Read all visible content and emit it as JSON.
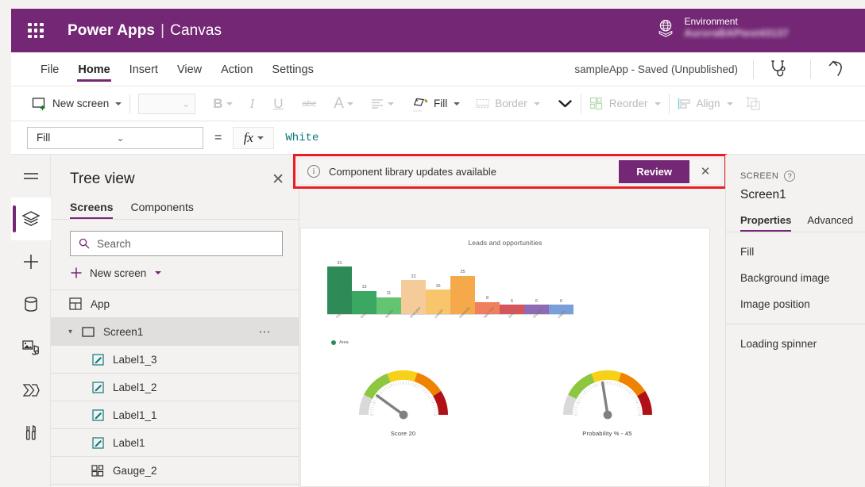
{
  "topbar": {
    "waffle_icon": "app-launcher-icon",
    "brand": "Power Apps",
    "separator": "|",
    "product": "Canvas",
    "environment_label": "Environment",
    "environment_name": "AuroraBAPtest43137",
    "globe_icon": "environment-globe-icon",
    "accent": "#742774"
  },
  "menubar": {
    "items": [
      {
        "label": "File",
        "active": false
      },
      {
        "label": "Home",
        "active": true
      },
      {
        "label": "Insert",
        "active": false
      },
      {
        "label": "View",
        "active": false
      },
      {
        "label": "Action",
        "active": false
      },
      {
        "label": "Settings",
        "active": false
      }
    ],
    "app_status": "sampleApp - Saved (Unpublished)",
    "checker_icon": "app-checker-stethoscope-icon",
    "undo_icon": "undo-arrow-icon"
  },
  "ribbon": {
    "new_screen": "New screen",
    "new_screen_icon": "new-screen-icon",
    "font_value": "",
    "bold": "B",
    "italic": "I",
    "underline": "U",
    "strikethrough": "abc",
    "font_color_icon": "font-color-icon",
    "align_icon": "text-align-icon",
    "fill": "Fill",
    "fill_icon": "fill-bucket-icon",
    "border": "Border",
    "border_icon": "border-icon",
    "more_icon": "chevron-down-icon",
    "reorder": "Reorder",
    "reorder_icon": "reorder-icon",
    "align": "Align",
    "align_tool_icon": "align-icon",
    "group_icon": "group-icon"
  },
  "formula_bar": {
    "property": "Fill",
    "equals": "=",
    "fx": "fx",
    "value": "White"
  },
  "rail": {
    "items": [
      {
        "name": "menu-hamburger",
        "icon": "hamburger-icon",
        "active": false
      },
      {
        "name": "tree-view",
        "icon": "layers-icon",
        "active": true
      },
      {
        "name": "insert",
        "icon": "plus-icon",
        "active": false
      },
      {
        "name": "data",
        "icon": "database-icon",
        "active": false
      },
      {
        "name": "media",
        "icon": "media-icon",
        "active": false
      },
      {
        "name": "power-automate",
        "icon": "power-automate-icon",
        "active": false
      },
      {
        "name": "advanced-tools",
        "icon": "advanced-tools-icon",
        "active": false
      }
    ]
  },
  "tree_view": {
    "title": "Tree view",
    "close_icon": "close-icon",
    "tabs": [
      {
        "label": "Screens",
        "active": true
      },
      {
        "label": "Components",
        "active": false
      }
    ],
    "search_placeholder": "Search",
    "search_value": "",
    "search_icon": "search-icon",
    "new_screen": "New screen",
    "new_screen_plus_icon": "plus-icon",
    "new_screen_chevron_icon": "chevron-down-icon",
    "items": [
      {
        "label": "App",
        "icon": "app-icon",
        "level": 0,
        "selected": false,
        "expandable": false,
        "overflow": false
      },
      {
        "label": "Screen1",
        "icon": "screen-icon",
        "level": 0,
        "selected": true,
        "expandable": true,
        "overflow": true,
        "overflow_icon": "more-options-icon"
      },
      {
        "label": "Label1_3",
        "icon": "label-icon",
        "level": 1,
        "selected": false,
        "expandable": false,
        "overflow": false
      },
      {
        "label": "Label1_2",
        "icon": "label-icon",
        "level": 1,
        "selected": false,
        "expandable": false,
        "overflow": false
      },
      {
        "label": "Label1_1",
        "icon": "label-icon",
        "level": 1,
        "selected": false,
        "expandable": false,
        "overflow": false
      },
      {
        "label": "Label1",
        "icon": "label-icon",
        "level": 1,
        "selected": false,
        "expandable": false,
        "overflow": false
      },
      {
        "label": "Gauge_2",
        "icon": "gauge-component-icon",
        "level": 1,
        "selected": false,
        "expandable": false,
        "overflow": false
      }
    ]
  },
  "banner": {
    "info_icon": "info-icon",
    "message": "Component library updates available",
    "review_label": "Review",
    "close_icon": "close-icon",
    "highlight_color": "#ed1c24",
    "button_color": "#742774"
  },
  "properties_panel": {
    "kind": "SCREEN",
    "help_icon": "help-question-icon",
    "name": "Screen1",
    "tabs": [
      {
        "label": "Properties",
        "active": true
      },
      {
        "label": "Advanced",
        "active": false
      }
    ],
    "group1": [
      "Fill",
      "Background image",
      "Image position"
    ],
    "group2": [
      "Loading spinner"
    ]
  },
  "chart_data": [
    {
      "type": "bar",
      "title": "Leads and opportunities",
      "xlabel": "",
      "ylabel": "",
      "ylim": [
        0,
        31
      ],
      "grid": false,
      "legend": {
        "position": "bottom-left",
        "entries": [
          {
            "name": "Area",
            "color": "#2e8b57"
          }
        ]
      },
      "categories": [
        "Cairo",
        "Dubai",
        "Seattle",
        "Shanghai",
        "London",
        "Hamburg",
        "New York",
        "Seoul",
        "Shanghai",
        "Lagos"
      ],
      "values": [
        31,
        15,
        11,
        22,
        16,
        25,
        8,
        6,
        6,
        6
      ],
      "colors": [
        "#2e8b57",
        "#3aa862",
        "#63c472",
        "#f5cb9a",
        "#f8c56c",
        "#f5a94a",
        "#ef7f5e",
        "#d4565a",
        "#8e6bb5",
        "#7a9ed8"
      ]
    },
    {
      "type": "gauge",
      "title": "Score",
      "label": "Score    20",
      "value": 20,
      "min": 0,
      "max": 100,
      "bands": [
        {
          "color": "#d9d9d9",
          "to": 15
        },
        {
          "color": "#8dc63f",
          "to": 38
        },
        {
          "color": "#f7d117",
          "to": 60
        },
        {
          "color": "#ef8200",
          "to": 82
        },
        {
          "color": "#b01116",
          "to": 100
        }
      ]
    },
    {
      "type": "gauge",
      "title": "Probability %",
      "label": "Probability % -  45",
      "value": 45,
      "min": 0,
      "max": 100,
      "bands": [
        {
          "color": "#d9d9d9",
          "to": 15
        },
        {
          "color": "#8dc63f",
          "to": 38
        },
        {
          "color": "#f7d117",
          "to": 60
        },
        {
          "color": "#ef8200",
          "to": 82
        },
        {
          "color": "#b01116",
          "to": 100
        }
      ]
    }
  ]
}
